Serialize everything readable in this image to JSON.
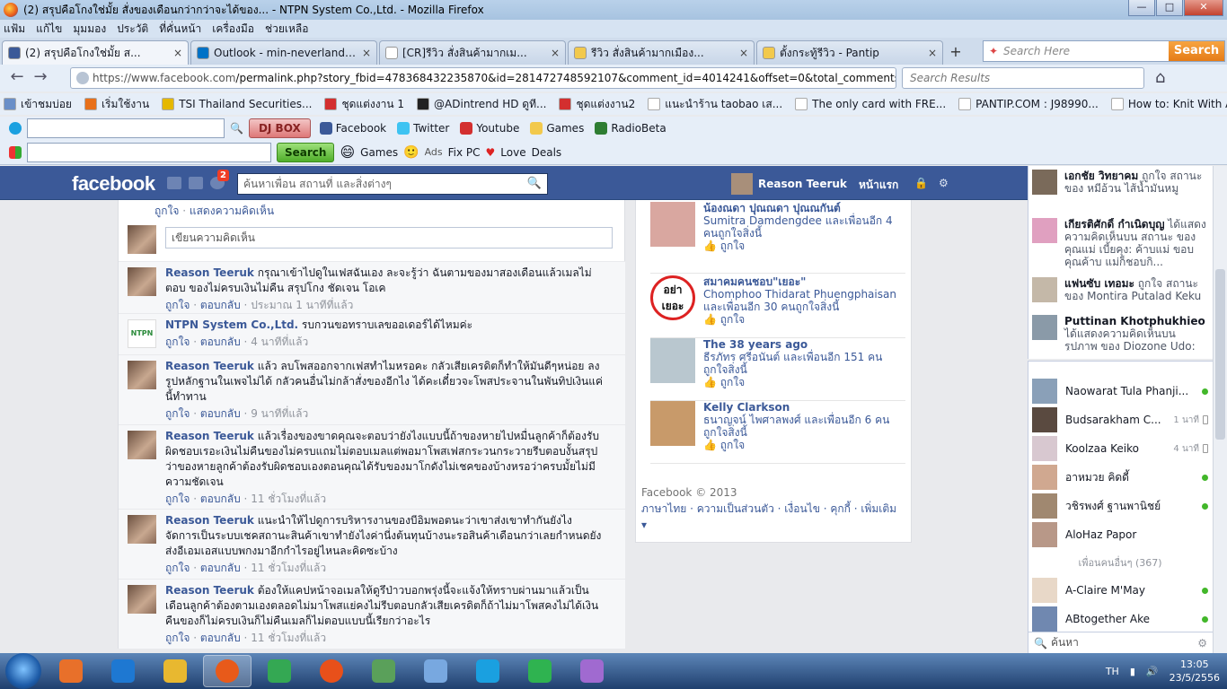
{
  "window": {
    "title": "(2) สรุปคือโกงใช่มั้ย สั่งของเดือนกว่ากว่าจะได้ของ... - NTPN System Co.,Ltd. - Mozilla Firefox",
    "min": "—",
    "max": "□",
    "close": "✕"
  },
  "menu": [
    "แฟ้ม",
    "แก้ไข",
    "มุมมอง",
    "ประวัติ",
    "ที่คั่นหน้า",
    "เครื่องมือ",
    "ช่วยเหลือ"
  ],
  "tabs": [
    {
      "label": "(2) สรุปคือโกงใช่มั้ย ส...",
      "color": "#3b5998",
      "active": true
    },
    {
      "label": "Outlook - min-neverland@ho...",
      "color": "#0072c6",
      "active": false
    },
    {
      "label": "[CR]รีวิว สั่งสินค้ามากเม...",
      "color": "#ffffff",
      "active": false
    },
    {
      "label": "รีวิว สั่งสินค้ามากเมือง...",
      "color": "#f2c94c",
      "active": false
    },
    {
      "label": "ตั้งกระทู้รีวิว - Pantip",
      "color": "#f2c94c",
      "active": false
    }
  ],
  "newtab": "+",
  "search": {
    "placeholder": "Search Here",
    "button": "Search"
  },
  "nav": {
    "back": "←",
    "forward": "→",
    "url_domain": "https://www.facebook.com",
    "url_rest": "/permalink.php?story_fbid=478368432235870&id=281472748592107&comment_id=4014241&offset=0&total_comments=11&notif",
    "search_placeholder": "Search Results",
    "home": "⌂"
  },
  "bookmarks": [
    {
      "label": "เข้าชมบ่อย",
      "color": "#6a8fc8"
    },
    {
      "label": "เริ่มใช้งาน",
      "color": "#e8701a"
    },
    {
      "label": "TSI Thailand Securities...",
      "color": "#e5b800"
    },
    {
      "label": "ชุดแต่งงาน 1",
      "color": "#d32f2f"
    },
    {
      "label": "@ADintrend HD ดูที...",
      "color": "#222222"
    },
    {
      "label": "ชุดแต่งงาน2",
      "color": "#d32f2f"
    },
    {
      "label": "แนะนำร้าน taobao เส...",
      "color": "#ffffff"
    },
    {
      "label": "The only card with FRE...",
      "color": "#ffffff"
    },
    {
      "label": "PANTIP.COM : J98990...",
      "color": "#ffffff"
    },
    {
      "label": "How to: Knit With A L...",
      "color": "#ffffff"
    }
  ],
  "toolbar1": {
    "djbox": "DJ BOX",
    "items": [
      {
        "label": "Facebook",
        "color": "#3b5998"
      },
      {
        "label": "Twitter",
        "color": "#3ec3f2"
      },
      {
        "label": "Youtube",
        "color": "#d32f2f"
      },
      {
        "label": "Games",
        "color": "#f2c94c"
      },
      {
        "label": "RadioBeta",
        "color": "#2e7d32"
      }
    ]
  },
  "toolbar2": {
    "search": "Search",
    "items": [
      "Games",
      "Ads",
      "Fix PC",
      "Love",
      "Deals"
    ]
  },
  "fb": {
    "logo": "facebook",
    "badge": "2",
    "search_placeholder": "ค้นหาเพื่อน สถานที่ และสิ่งต่างๆ",
    "user": "Reason Teeruk",
    "home": "หน้าแรก",
    "top_actions": {
      "like": "ถูกใจ",
      "sep": " · ",
      "show": "แสดงความคิดเห็น"
    },
    "write_placeholder": "เขียนความคิดเห็น",
    "comments": [
      {
        "name": "Reason Teeruk",
        "text": " กรุณาเข้าไปดูในเฟสฉันเอง ละจะรู้ว่า ฉันตามของมาสองเดือนแล้วเมลไม่ตอบ ของไม่ครบเงินไม่คืน สรุปโกง ชัดเจน โอเค",
        "like": "ถูกใจ",
        "reply": "ตอบกลับ",
        "time": "ประมาณ 1 นาทีที่แล้ว",
        "avatar": "girl"
      },
      {
        "name": "NTPN System Co.,Ltd.",
        "text": " รบกวนขอทราบเลขออเดอร์ได้ไหมค่ะ",
        "like": "ถูกใจ",
        "reply": "ตอบกลับ",
        "time": "4 นาทีที่แล้ว",
        "avatar": "ntpn"
      },
      {
        "name": "Reason Teeruk",
        "text": " แล้ว ลบโพสออกจากเฟสทำไมหรอคะ กลัวเสียเครดิตก็ทำให้มันดีๆหน่อย ลงรูปหลักฐานในเพจไม่ได้ กลัวคนอื่นไม่กล้าสั่งของอีกไง ได้คะเดี๋ยวจะโพสประจานในพันทิปเงินแค่นี้ทำทาน",
        "like": "ถูกใจ",
        "reply": "ตอบกลับ",
        "time": "9 นาทีที่แล้ว",
        "avatar": "girl"
      },
      {
        "name": "Reason Teeruk",
        "text": " แล้วเรื่องของขาดคุณจะตอบว่ายังไงแบบนี้ถ้าของหายไปหมื่นลูกค้าก็ต้องรับผิดชอบเรอะเงินไม่คืนของไม่ครบแถมไม่ตอบเมลแต่พอมาโพสเฟสกระวนกระวายรีบตอบงั้นสรุปว่าของหายลูกค้าต้องรับผิดชอบเองตอนคุณได้รับของมาโกดังไม่เชคของบ้างหรอว่าครบมั้ยไม่มีความชัดเจน",
        "like": "ถูกใจ",
        "reply": "ตอบกลับ",
        "time": "11 ชั่วโมงที่แล้ว",
        "avatar": "girl"
      },
      {
        "name": "Reason Teeruk",
        "text": " แนะนำให้ไปดูการบริหารงานของบีอิมพอตนะว่าเขาส่งเขาทำกันยังไง จัดการเป็นระบบเชคสถานะสินค้าเขาทำยังไงค่านี่งต้นทุนบ้างนะรอสินค้าเดือนกว่าเลยกำหนดยังส่งอีเอมเอสแบบพกงมาอีกกำไรอยู่ไหนละคิดซะบ้าง",
        "like": "ถูกใจ",
        "reply": "ตอบกลับ",
        "time": "11 ชั่วโมงที่แล้ว",
        "avatar": "girl"
      },
      {
        "name": "Reason Teeruk",
        "text": " ต้องให้แคปหน้าจอเมลให้ดูรึป่าวบอกพรุ่งนี้จะแจ้งให้ทราบผ่านมาแล้วเป็นเดือนลูกค้าต้องตามเองตลอดไม่มาโพสแย่คงไม่รีบตอบกลัวเสียเครดิตก็ถ้าไม่มาโพสคงไม่ได้เงินคืนของก็ไม่ครบเงินก็ไม่คืนเมลก็ไม่ตอบแบบนี้เรียกว่าอะไร",
        "like": "ถูกใจ",
        "reply": "ตอบกลับ",
        "time": "11 ชั่วโมงที่แล้ว",
        "avatar": "girl"
      }
    ],
    "suggestions": [
      {
        "name": "น้องณดา ปุณณดา ปุณณกันต์",
        "sub": "Sumitra Damdengdee และเพื่อนอีก 4 คนถูกใจสิ่งนี้",
        "like": "ถูกใจ",
        "color": "#d9a7a0"
      },
      {
        "name": "สมาคมคนชอบ\"เยอะ\"",
        "sub": "Chomphoo Thidarat Phuengphaisan และเพื่อนอีก 30 คนถูกใจสิ่งนี้",
        "like": "ถูกใจ",
        "color": "#ffffff",
        "sign": "อย่า เยอะ"
      },
      {
        "name": "The 38 years ago",
        "sub": "ธีรภัทร ศรีอนันต์ และเพื่อนอีก 151 คนถูกใจสิ่งนี้",
        "like": "ถูกใจ",
        "color": "#b9c7cf"
      },
      {
        "name": "Kelly Clarkson",
        "sub": "ธนาญจน์ ไพศาลพงศ์ และเพื่อนอีก 6 คนถูกใจสิ่งนี้",
        "like": "ถูกใจ",
        "color": "#c89a6a"
      }
    ],
    "footer": {
      "copyright": "Facebook © 2013",
      "links": "ภาษาไทย · ความเป็นส่วนตัว · เงื่อนไข · คุกกี้ · เพิ่มเติม ▾"
    },
    "ticker": [
      {
        "name": "เอกชัย วิทยาคม",
        "text": " ถูกใจ สถานะ ของ หมีอ้วน ไส้น้ำมันหมู",
        "color": "#7a6a5a"
      },
      {
        "name": "เกียรติศักดิ์ กำเนิดบุญ",
        "text": " ได้แสดงความคิดเห็นบน สถานะ ของ คุณแม่ เบี้ยคุง: ค้าบแม่ ขอบคุณค้าบ แม่ก็ชอบกิ...",
        "color": "#e0a0c0"
      },
      {
        "name": "แฟนซับ เทอมะ",
        "text": " ถูกใจ สถานะของ Montira Putalad Keku",
        "color": "#c4b8a8"
      },
      {
        "name": "Puttinan Khotphukhieo",
        "text": " ได้แสดงความคิดเห็นบน รูปภาพ ของ Diozone Udo: ใคร เป็นไรเป่าคับ",
        "color": "#8a9aa8"
      }
    ],
    "chat": [
      {
        "name": "Naowarat Tula Phanji...",
        "status": "online",
        "time": "",
        "color": "#8aa0b8"
      },
      {
        "name": "Budsarakham C...",
        "status": "mobile",
        "time": "1 นาที",
        "color": "#5a4a40"
      },
      {
        "name": "Koolzaa Keiko",
        "status": "mobile",
        "time": "4 นาที",
        "color": "#d8c8d0"
      },
      {
        "name": "อาหมวย คิดดี้",
        "status": "online",
        "time": "",
        "color": "#d0a890"
      },
      {
        "name": "วชิรพงศ์ ฐานพานิชย์",
        "status": "online",
        "time": "",
        "color": "#a08870"
      },
      {
        "name": "AloHaz Papor",
        "status": "none",
        "time": "",
        "color": "#b89888"
      }
    ],
    "more_friends": "เพื่อนคนอื่นๆ (367)",
    "chat_more": [
      {
        "name": "A-Claire M'May",
        "status": "online",
        "color": "#e8d8c8"
      },
      {
        "name": "ABtogether Ake",
        "status": "online",
        "color": "#7088b0"
      }
    ],
    "chat_search": "ค้นหา"
  },
  "taskbar": {
    "apps": [
      "#e8702a",
      "#1e78d2",
      "#e8b830",
      "#e85a1a",
      "#34a853",
      "#e8501a",
      "#5aa05a",
      "#78a8e0",
      "#1aa0e0",
      "#2fb350",
      "#a06ad0"
    ],
    "lang": "TH",
    "time": "13:05",
    "date": "23/5/2556"
  }
}
